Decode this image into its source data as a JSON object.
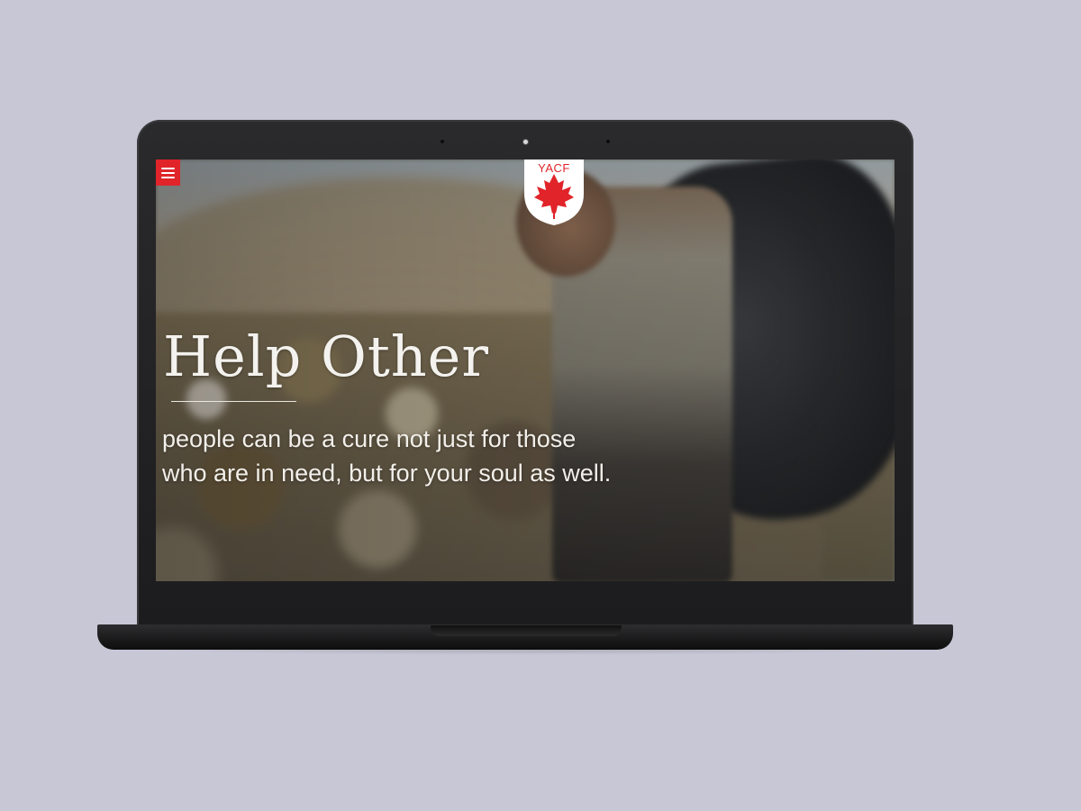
{
  "app": {
    "brand_initials": "YACF",
    "accent_color": "#e0242a",
    "logo_icon": "maple-leaf-icon"
  },
  "nav": {
    "menu_icon": "hamburger-menu-icon"
  },
  "hero": {
    "title": "Help Other",
    "text_line_1": "people can be a cure not just for those",
    "text_line_2": "who are in need, but for your soul as well.",
    "background_description_icon": "photo-background"
  }
}
